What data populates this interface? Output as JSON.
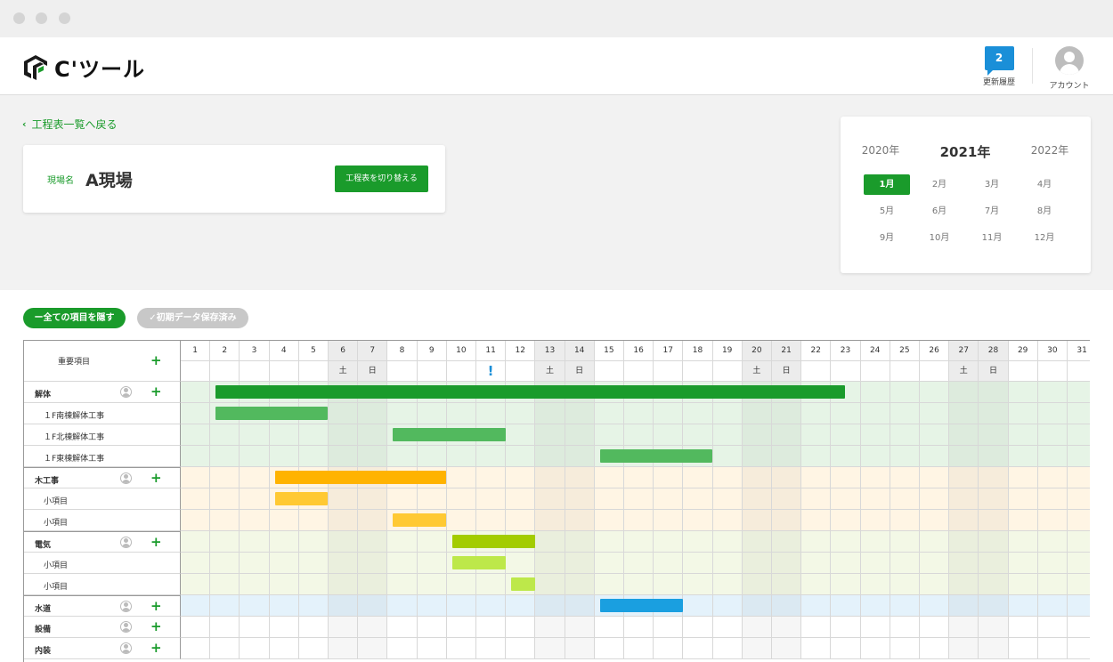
{
  "app": {
    "logo_text": "C'ツール"
  },
  "header": {
    "history": {
      "count": "2",
      "label": "更新履歴"
    },
    "account": {
      "label": "アカウント"
    }
  },
  "back_link": "工程表一覧へ戻る",
  "site": {
    "label": "現場名",
    "name": "A現場",
    "switch_button": "工程表を切り替える"
  },
  "calendar": {
    "years": [
      "2020年",
      "2021年",
      "2022年"
    ],
    "current_year": "2021年",
    "months": [
      "1月",
      "2月",
      "3月",
      "4月",
      "5月",
      "6月",
      "7月",
      "8月",
      "9月",
      "10月",
      "11月",
      "12月"
    ],
    "selected_month": "1月"
  },
  "toolbar": {
    "hide_all": "ー全ての項目を隠す",
    "saved": "✓初期データ保存済み"
  },
  "gantt": {
    "header_label": "重要項目",
    "days": 31,
    "weekday_labels": {
      "6": "土",
      "7": "日",
      "13": "土",
      "14": "日",
      "20": "土",
      "21": "日",
      "27": "土",
      "28": "日"
    },
    "alert_day": 11,
    "alert_mark": "!",
    "weekend_days": [
      6,
      7,
      13,
      14,
      20,
      21,
      27,
      28
    ],
    "rows": [
      {
        "label": "解体",
        "kind": "main",
        "color": "#e6f4e6",
        "bar": {
          "start": 2,
          "end": 23.3,
          "color": "#1a9b2b"
        }
      },
      {
        "label": "１F南棟解体工事",
        "kind": "sub",
        "color": "#e6f4e6",
        "bar": {
          "start": 2,
          "end": 5.8,
          "color": "#52b95e"
        }
      },
      {
        "label": "１F北棟解体工事",
        "kind": "sub",
        "color": "#e6f4e6",
        "bar": {
          "start": 8,
          "end": 11.8,
          "color": "#52b95e"
        }
      },
      {
        "label": "１F東棟解体工事",
        "kind": "sub",
        "color": "#e6f4e6",
        "bar": {
          "start": 15,
          "end": 18.8,
          "color": "#52b95e"
        }
      },
      {
        "label": "木工事",
        "kind": "main",
        "color": "#fff5e4",
        "bar": {
          "start": 4,
          "end": 9.8,
          "color": "#ffb300"
        }
      },
      {
        "label": "小項目",
        "kind": "sub",
        "color": "#fff5e4",
        "bar": {
          "start": 4,
          "end": 5.8,
          "color": "#ffc933"
        }
      },
      {
        "label": "小項目",
        "kind": "sub",
        "color": "#fff5e4",
        "bar": {
          "start": 8,
          "end": 9.8,
          "color": "#ffc933"
        }
      },
      {
        "label": "電気",
        "kind": "main",
        "color": "#f3f8e6",
        "bar": {
          "start": 10,
          "end": 12.8,
          "color": "#a3cc00"
        }
      },
      {
        "label": "小項目",
        "kind": "sub",
        "color": "#f3f8e6",
        "bar": {
          "start": 10,
          "end": 11.8,
          "color": "#bde84a"
        }
      },
      {
        "label": "小項目",
        "kind": "sub",
        "color": "#f3f8e6",
        "bar": {
          "start": 12,
          "end": 12.8,
          "color": "#bde84a"
        }
      },
      {
        "label": "水道",
        "kind": "main",
        "color": "#e4f2fb",
        "bar": {
          "start": 15,
          "end": 17.8,
          "color": "#1a9fe0"
        }
      },
      {
        "label": "設備",
        "kind": "main",
        "color": "#ffffff",
        "bar": null
      },
      {
        "label": "内装",
        "kind": "main",
        "color": "#ffffff",
        "bar": null
      }
    ]
  }
}
